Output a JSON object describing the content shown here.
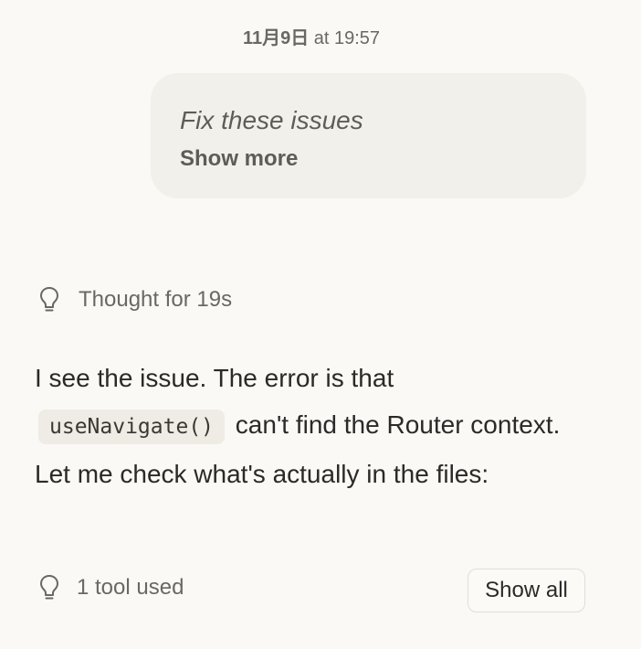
{
  "header": {
    "date": "11月9日",
    "time": "at 19:57"
  },
  "user_message": {
    "text": "Fix these issues",
    "show_more_label": "Show more"
  },
  "thought": {
    "label": "Thought for 19s",
    "icon": "lightbulb-icon"
  },
  "response": {
    "text_before": "I see the issue. The error is that",
    "code": "useNavigate()",
    "text_after": "can't find the Router context. Let me check what's actually in the files:"
  },
  "tools": {
    "label": "1 tool used",
    "icon": "lightbulb-icon",
    "show_all_label": "Show all"
  },
  "colors": {
    "background": "#faf9f6",
    "bubble": "#f2f0ea",
    "code_bg": "#efece5"
  }
}
